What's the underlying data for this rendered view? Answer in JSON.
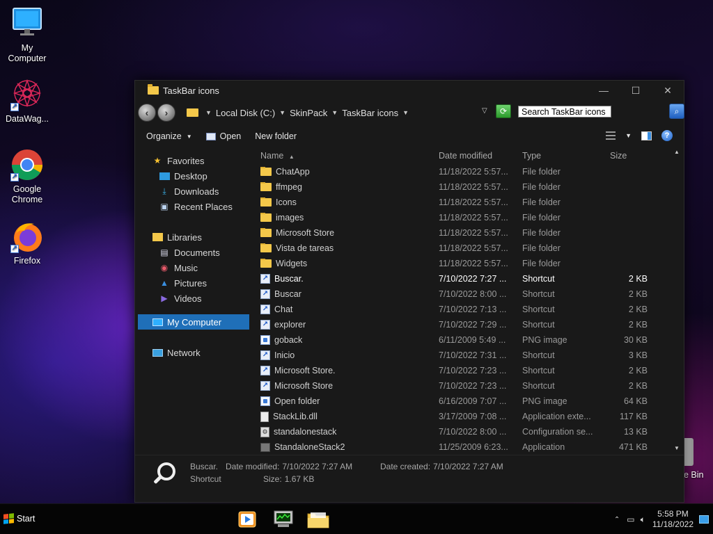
{
  "desktop": {
    "icons": [
      {
        "label": "My Computer",
        "line1": "My",
        "line2": "Computer"
      },
      {
        "label": "DataWag...",
        "line1": "DataWag...",
        "line2": ""
      },
      {
        "label": "Google Chrome",
        "line1": "Google",
        "line2": "Chrome"
      },
      {
        "label": "Firefox",
        "line1": "Firefox",
        "line2": ""
      }
    ],
    "recycle_bin_partial": "e Bin"
  },
  "window": {
    "title": "TaskBar icons",
    "controls": {
      "minimize": "—",
      "maximize": "☐",
      "close": "✕"
    },
    "breadcrumbs": [
      "Local Disk (C:)",
      "SkinPack",
      "TaskBar icons"
    ],
    "search": {
      "value": "Search TaskBar icons"
    },
    "toolbar": {
      "organize": "Organize",
      "open": "Open",
      "new_folder": "New folder"
    },
    "nav": {
      "favorites": "Favorites",
      "desktop": "Desktop",
      "downloads": "Downloads",
      "recent_places": "Recent Places",
      "libraries": "Libraries",
      "documents": "Documents",
      "music": "Music",
      "pictures": "Pictures",
      "videos": "Videos",
      "my_computer": "My Computer",
      "network": "Network"
    },
    "columns": {
      "name": "Name",
      "date": "Date modified",
      "type": "Type",
      "size": "Size"
    },
    "files": [
      {
        "name": "ChatApp",
        "date": "11/18/2022 5:57...",
        "type": "File folder",
        "size": "",
        "icon": "folder"
      },
      {
        "name": "ffmpeg",
        "date": "11/18/2022 5:57...",
        "type": "File folder",
        "size": "",
        "icon": "folder"
      },
      {
        "name": "Icons",
        "date": "11/18/2022 5:57...",
        "type": "File folder",
        "size": "",
        "icon": "folder"
      },
      {
        "name": "images",
        "date": "11/18/2022 5:57...",
        "type": "File folder",
        "size": "",
        "icon": "folder"
      },
      {
        "name": "Microsoft Store",
        "date": "11/18/2022 5:57...",
        "type": "File folder",
        "size": "",
        "icon": "folder"
      },
      {
        "name": "Vista de tareas",
        "date": "11/18/2022 5:57...",
        "type": "File folder",
        "size": "",
        "icon": "folder"
      },
      {
        "name": "Widgets",
        "date": "11/18/2022 5:57...",
        "type": "File folder",
        "size": "",
        "icon": "folder"
      },
      {
        "name": "Buscar.",
        "date": "7/10/2022 7:27 ...",
        "type": "Shortcut",
        "size": "2 KB",
        "icon": "shortcut"
      },
      {
        "name": "Buscar",
        "date": "7/10/2022 8:00 ...",
        "type": "Shortcut",
        "size": "2 KB",
        "icon": "shortcut"
      },
      {
        "name": "Chat",
        "date": "7/10/2022 7:13 ...",
        "type": "Shortcut",
        "size": "2 KB",
        "icon": "shortcut"
      },
      {
        "name": "explorer",
        "date": "7/10/2022 7:29 ...",
        "type": "Shortcut",
        "size": "2 KB",
        "icon": "shortcut"
      },
      {
        "name": "goback",
        "date": "6/11/2009 5:49 ...",
        "type": "PNG image",
        "size": "30 KB",
        "icon": "image"
      },
      {
        "name": "Inicio",
        "date": "7/10/2022 7:31 ...",
        "type": "Shortcut",
        "size": "3 KB",
        "icon": "shortcut"
      },
      {
        "name": "Microsoft Store.",
        "date": "7/10/2022 7:23 ...",
        "type": "Shortcut",
        "size": "2 KB",
        "icon": "shortcut"
      },
      {
        "name": "Microsoft Store",
        "date": "7/10/2022 7:23 ...",
        "type": "Shortcut",
        "size": "2 KB",
        "icon": "shortcut"
      },
      {
        "name": "Open folder",
        "date": "6/16/2009 7:07 ...",
        "type": "PNG image",
        "size": "64 KB",
        "icon": "image"
      },
      {
        "name": "StackLib.dll",
        "date": "3/17/2009 7:08 ...",
        "type": "Application exte...",
        "size": "117 KB",
        "icon": "file"
      },
      {
        "name": "standalonestack",
        "date": "7/10/2022 8:00 ...",
        "type": "Configuration se...",
        "size": "13 KB",
        "icon": "config"
      },
      {
        "name": "StandaloneStack2",
        "date": "11/25/2009 6:23...",
        "type": "Application",
        "size": "471 KB",
        "icon": "app"
      }
    ],
    "details": {
      "name": "Buscar.",
      "type": "Shortcut",
      "date_modified_label": "Date modified:",
      "date_modified": "7/10/2022 7:27 AM",
      "date_created_label": "Date created:",
      "date_created": "7/10/2022 7:27 AM",
      "size_label": "Size:",
      "size": "1.67 KB"
    }
  },
  "taskbar": {
    "start_label": "Start",
    "time": "5:58 PM",
    "date": "11/18/2022"
  },
  "colors": {
    "accent": "#1f6fb8",
    "window_bg": "#191919"
  }
}
